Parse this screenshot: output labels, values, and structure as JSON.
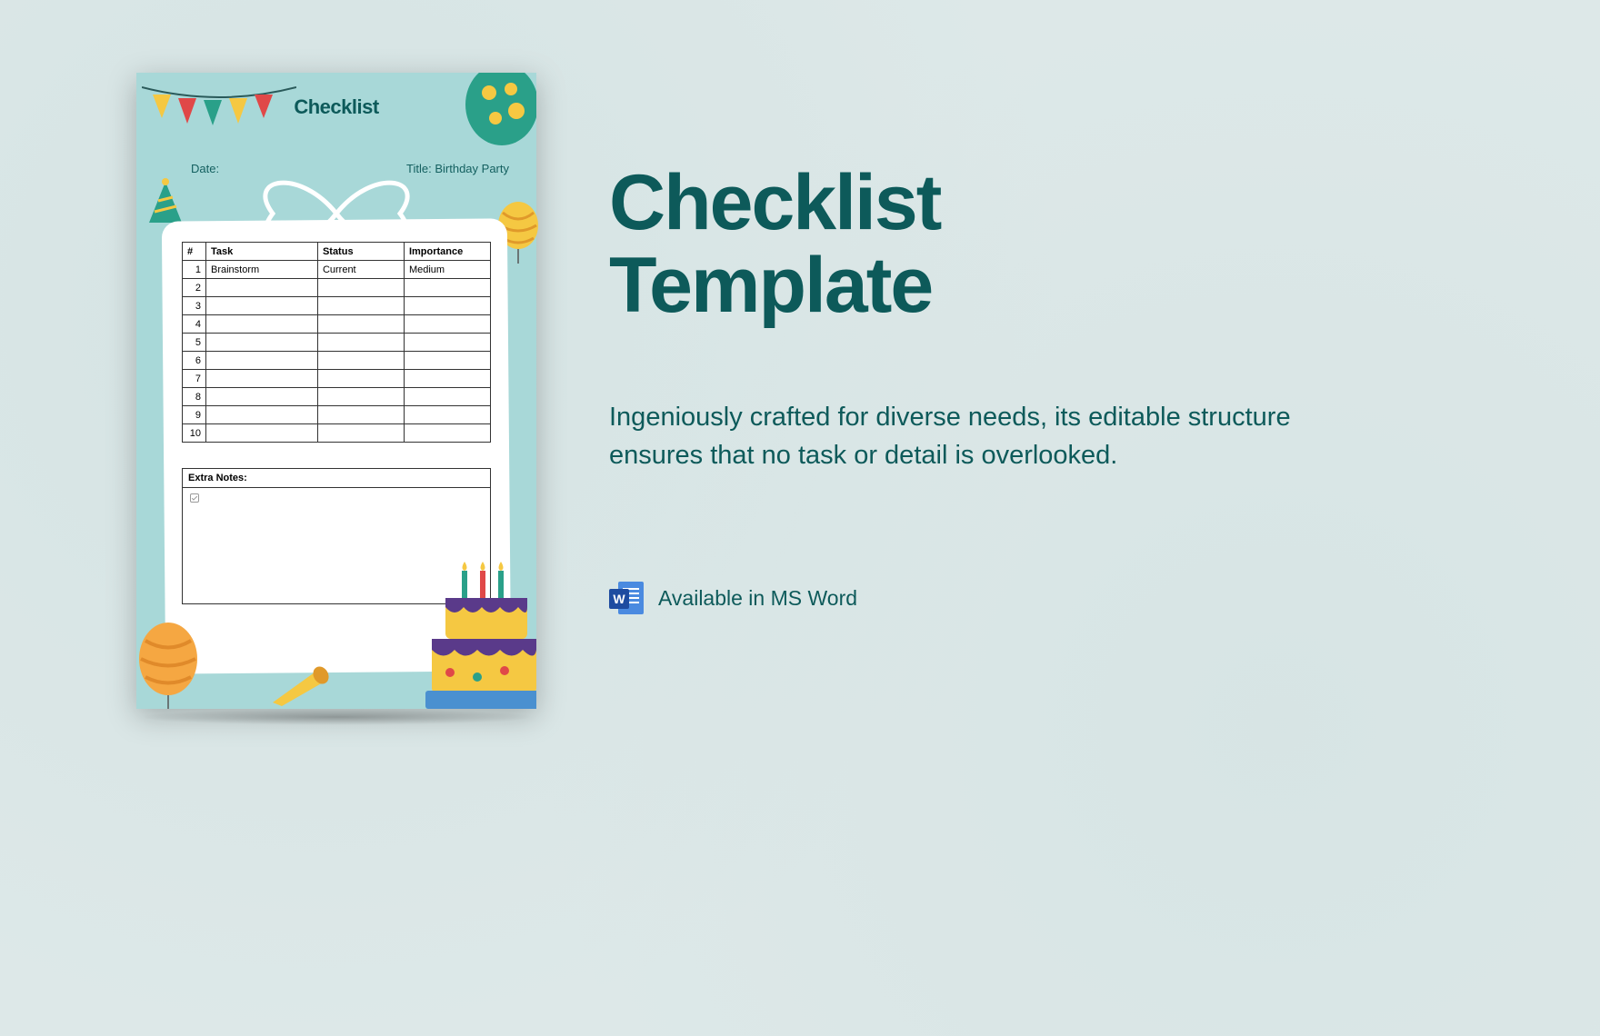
{
  "headline_line1": "Checklist",
  "headline_line2": "Template",
  "description": "Ingeniously crafted for diverse needs, its editable structure ensures that no task or detail is overlooked.",
  "availability": "Available in MS Word",
  "word_letter": "W",
  "template": {
    "title": "Checklist",
    "date_label": "Date:",
    "title_label": "Title: Birthday Party",
    "columns": {
      "num": "#",
      "task": "Task",
      "status": "Status",
      "importance": "Importance"
    },
    "rows": [
      {
        "n": "1",
        "task": "Brainstorm",
        "status": "Current",
        "importance": "Medium"
      },
      {
        "n": "2",
        "task": "",
        "status": "",
        "importance": ""
      },
      {
        "n": "3",
        "task": "",
        "status": "",
        "importance": ""
      },
      {
        "n": "4",
        "task": "",
        "status": "",
        "importance": ""
      },
      {
        "n": "5",
        "task": "",
        "status": "",
        "importance": ""
      },
      {
        "n": "6",
        "task": "",
        "status": "",
        "importance": ""
      },
      {
        "n": "7",
        "task": "",
        "status": "",
        "importance": ""
      },
      {
        "n": "8",
        "task": "",
        "status": "",
        "importance": ""
      },
      {
        "n": "9",
        "task": "",
        "status": "",
        "importance": ""
      },
      {
        "n": "10",
        "task": "",
        "status": "",
        "importance": ""
      }
    ],
    "extra_notes_label": "Extra Notes:"
  }
}
